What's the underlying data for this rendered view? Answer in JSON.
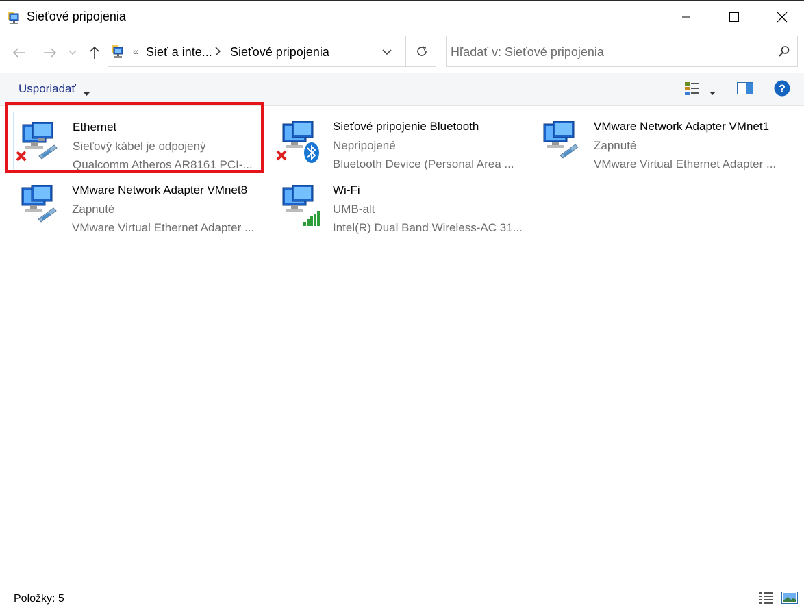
{
  "window": {
    "title": "Sieťové pripojenia",
    "controls": [
      "minimize",
      "maximize",
      "close"
    ]
  },
  "address_bar": {
    "overflow": "«",
    "crumbs": [
      "Sieť a inte...",
      "Sieťové pripojenia"
    ],
    "icon": "network-connections-icon"
  },
  "search": {
    "placeholder": "Hľadať v: Sieťové pripojenia"
  },
  "command_bar": {
    "organize_label": "Usporiadať"
  },
  "items": [
    {
      "name": "Ethernet",
      "status": "Sieťový kábel je odpojený",
      "device": "Qualcomm Atheros AR8161 PCI-...",
      "icon": "ethernet-disconnected-icon",
      "selected": true
    },
    {
      "name": "Sieťové pripojenie Bluetooth",
      "status": "Nepripojené",
      "device": "Bluetooth Device (Personal Area ...",
      "icon": "bluetooth-disconnected-icon",
      "selected": false
    },
    {
      "name": "VMware Network Adapter VMnet1",
      "status": "Zapnuté",
      "device": "VMware Virtual Ethernet Adapter ...",
      "icon": "ethernet-enabled-icon",
      "selected": false
    },
    {
      "name": "VMware Network Adapter VMnet8",
      "status": "Zapnuté",
      "device": "VMware Virtual Ethernet Adapter ...",
      "icon": "ethernet-enabled-icon",
      "selected": false
    },
    {
      "name": "Wi-Fi",
      "status": "UMB-alt",
      "device": "Intel(R) Dual Band Wireless-AC 31...",
      "icon": "wifi-signal-icon",
      "selected": false
    }
  ],
  "status_bar": {
    "count_label": "Položky: 5"
  },
  "colors": {
    "highlight": "#e5141b",
    "selection_border": "#cce8ff",
    "link_blue": "#1e3287",
    "help_blue": "#1565c0"
  }
}
